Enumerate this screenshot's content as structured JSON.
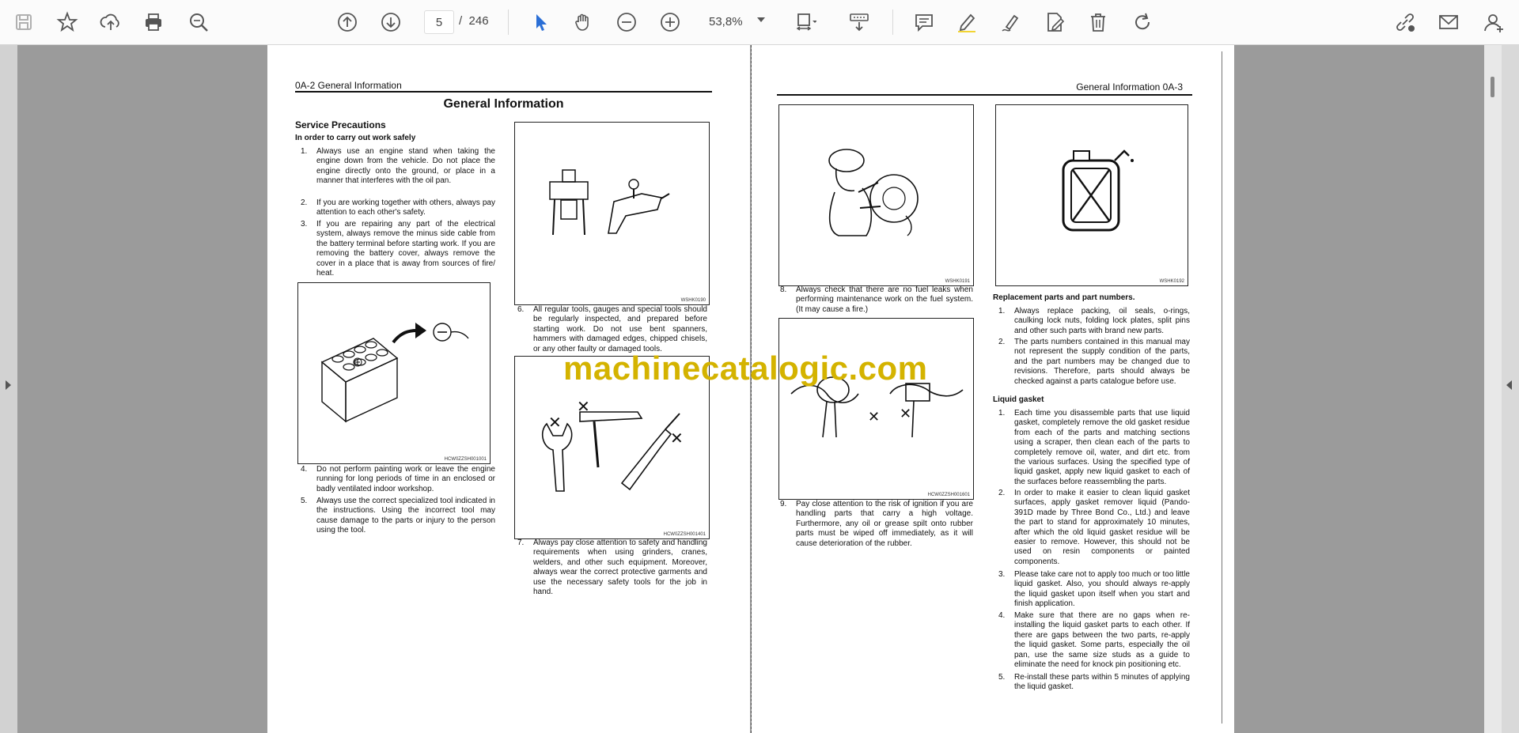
{
  "toolbar": {
    "page_current": "5",
    "page_separator": "/",
    "page_total": "246",
    "zoom": "53,8%",
    "icons": [
      "save-icon",
      "star-icon",
      "upload-icon",
      "print-icon",
      "zoom-search-icon",
      "page-up-icon",
      "page-down-icon",
      "select-cursor-icon",
      "hand-icon",
      "zoom-out-icon",
      "zoom-in-icon",
      "fit-page-icon",
      "scroll-mode-icon",
      "comment-icon",
      "highlight-icon",
      "sign-icon",
      "edit-pdf-icon",
      "delete-icon",
      "rotate-icon",
      "share-link-icon",
      "mail-icon",
      "account-icon"
    ]
  },
  "left_page": {
    "header": "0A-2   General Information",
    "title": "General Information",
    "section": "Service Precautions",
    "subsection": "In order to carry out work safely",
    "items_col1": [
      {
        "n": "1.",
        "text": "Always use an engine stand when taking the engine down from the vehicle. Do not place the engine directly onto the ground, or place in a manner that interferes with the oil pan."
      },
      {
        "n": "2.",
        "text": "If you are working together with others, always pay attention to each other's safety."
      },
      {
        "n": "3.",
        "text": "If you are repairing any part of the electrical system, always remove the minus side cable from the battery terminal before starting work. If you are removing the battery cover, always remove the cover in a place that is away from sources of fire/ heat."
      }
    ],
    "items_col1b": [
      {
        "n": "4.",
        "text": "Do not perform painting work or leave the engine running for long periods of time in an enclosed or badly ventilated indoor workshop."
      },
      {
        "n": "5.",
        "text": "Always use the correct specialized tool indicated in the instructions. Using the incorrect tool may cause damage to the parts or injury to the person using the tool."
      }
    ],
    "item6": {
      "n": "6.",
      "text": "All regular tools, gauges and special tools should be regularly inspected, and prepared before starting work. Do not use bent spanners, hammers with damaged edges, chipped chisels, or any other faulty or damaged tools."
    },
    "item7": {
      "n": "7.",
      "text": "Always pay close attention to safety and handling requirements when using grinders, cranes, welders, and other such equipment. Moreover, always wear the correct protective garments and use the necessary safety tools for the job in hand."
    },
    "fig_codes": [
      "HCW0ZZSH001001",
      "WSHK0190",
      "HCW0ZZSH001401"
    ]
  },
  "right_page": {
    "header": "General Information   0A-3",
    "item8": {
      "n": "8.",
      "text": "Always check that there are no fuel leaks when performing maintenance work on the fuel system. (It may cause a fire.)"
    },
    "item9": {
      "n": "9.",
      "text": "Pay close attention to the risk of ignition if you are handling parts that carry a high voltage. Furthermore, any oil or grease spilt onto rubber parts must be wiped off immediately, as it will cause deterioration of the rubber."
    },
    "section_parts": "Replacement parts and part numbers.",
    "parts_items": [
      {
        "n": "1.",
        "text": "Always replace packing, oil seals, o-rings, caulking lock nuts, folding lock plates, split pins and other such parts with brand new parts."
      },
      {
        "n": "2.",
        "text": "The parts numbers contained in this manual may not represent the supply condition of the parts, and the part numbers may be changed due to revisions. Therefore, parts should always be checked against a parts catalogue before use."
      }
    ],
    "section_gasket": "Liquid gasket",
    "gasket_items": [
      {
        "n": "1.",
        "text": "Each time you disassemble parts that use liquid gasket, completely remove the old gasket residue from each of the parts and matching sections using a scraper, then clean each of the parts to completely remove oil, water, and dirt etc. from the various surfaces. Using the specified type of liquid gasket, apply new liquid gasket to each of the surfaces before reassembling the parts."
      },
      {
        "n": "2.",
        "text": "In order to make it easier to clean liquid gasket surfaces, apply gasket remover liquid (Pando-391D made by Three Bond Co., Ltd.) and leave the part to stand for approximately 10 minutes, after which the old liquid gasket residue will be easier to remove. However, this should not be used on resin components or painted components."
      },
      {
        "n": "3.",
        "text": "Please take care not to apply too much or too little liquid gasket. Also, you should always re-apply the liquid gasket upon itself when you start and finish application."
      },
      {
        "n": "4.",
        "text": "Make sure that there are no gaps when re-installing the liquid gasket parts to each other. If there are gaps between the two parts, re-apply the liquid gasket. Some parts, especially the oil pan, use the same size studs as a guide to eliminate the need for knock pin positioning etc."
      },
      {
        "n": "5.",
        "text": "Re-install these parts within 5 minutes of applying the liquid gasket."
      }
    ],
    "fig_codes": [
      "WSHK0191",
      "WSHK0192",
      "HCW0ZZSH001601"
    ]
  },
  "watermark": "machinecatalogic.com"
}
